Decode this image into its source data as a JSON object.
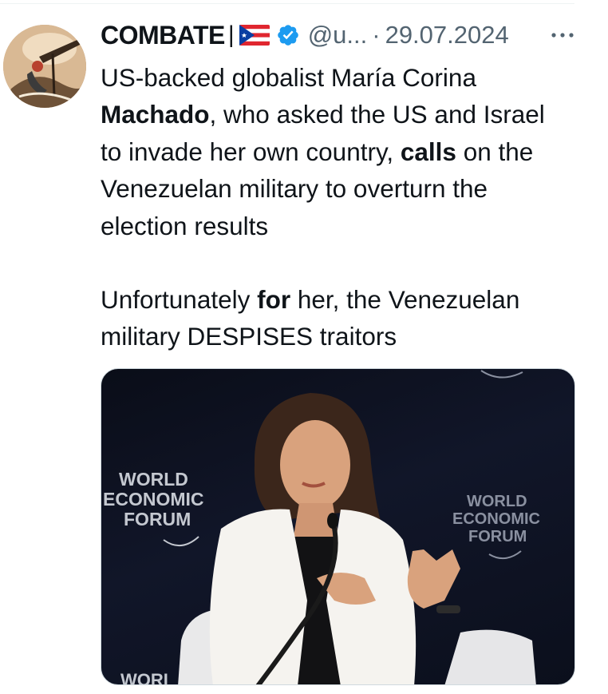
{
  "tweet": {
    "author_name": "COMBATE",
    "name_separator": "|",
    "handle": "@u...",
    "dot": "·",
    "date": "29.07.2024",
    "text": {
      "line1": "US-backed globalist María Corina",
      "line2_bold": "Machado",
      "line2_rest": ", who asked the US and Israel",
      "line3_start": "to invade her own country, ",
      "line3_bold": "calls",
      "line3_rest": " on the",
      "line4": "Venezuelan military to overturn the",
      "line5": "election results",
      "line6_start": "Unfortunately ",
      "line6_bold": "for",
      "line6_rest": " her, the Venezuelan",
      "line7": "military DESPISES traitors"
    },
    "media": {
      "logo_left": [
        "WORLD",
        "ECONOMIC",
        "FORUM"
      ],
      "logo_right": [
        "WORLD",
        "ECONOMIC",
        "FORUM"
      ],
      "logo_bottom_partial": "WORI"
    }
  },
  "colors": {
    "text": "#0f1419",
    "secondary": "#536471",
    "verified_blue": "#1d9bf0",
    "flag_red": "#e0262f",
    "flag_blue": "#0a3fa3"
  },
  "icons": [
    "verified-badge-icon",
    "puerto-rico-flag-icon",
    "more-options-icon"
  ]
}
